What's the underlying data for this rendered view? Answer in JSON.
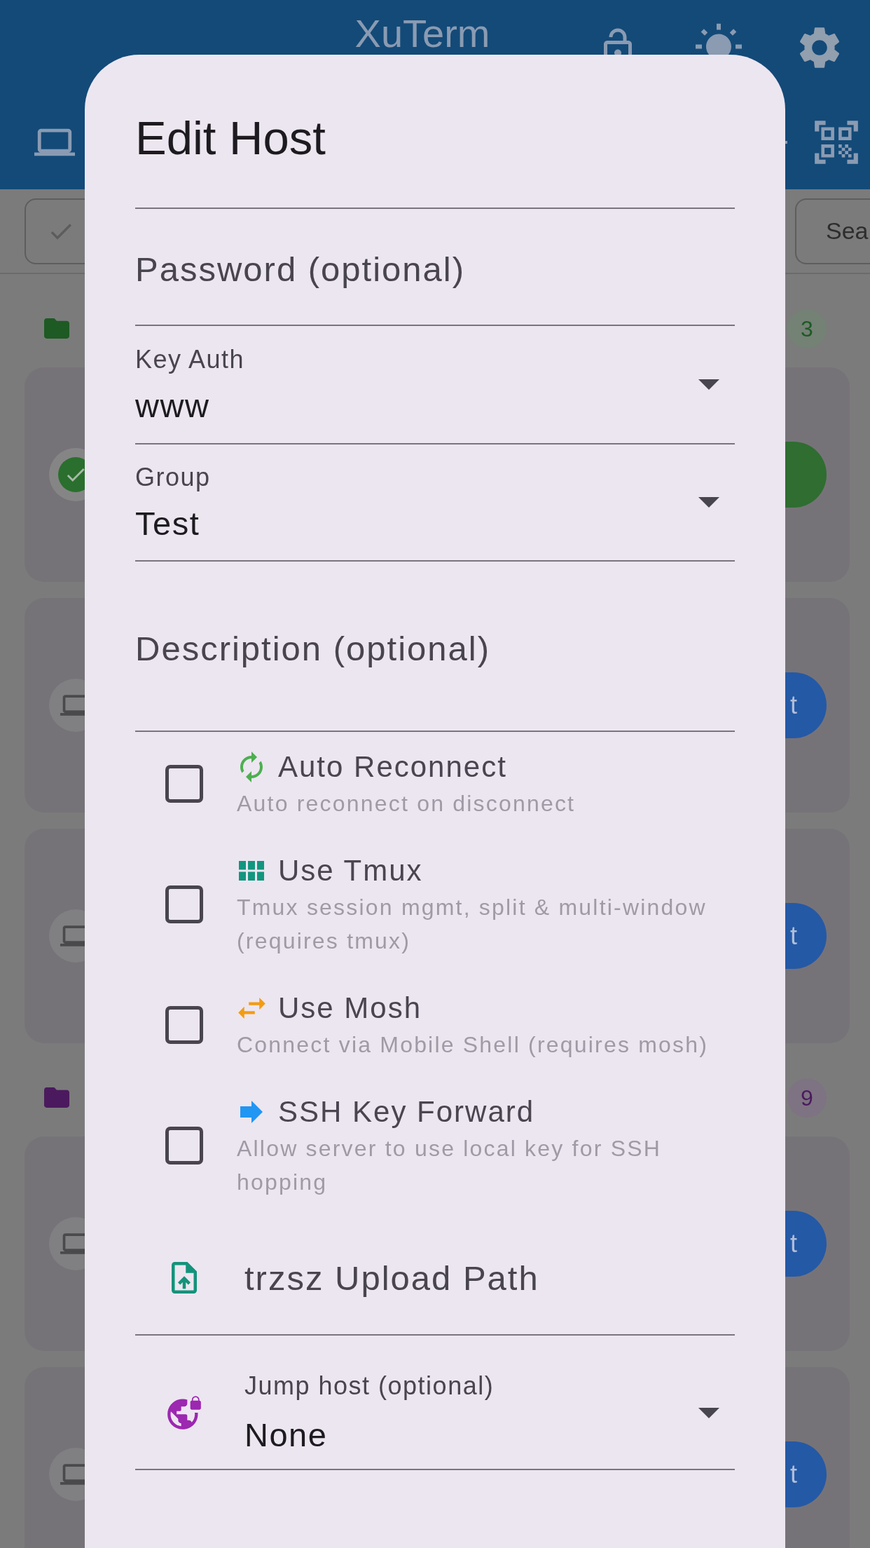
{
  "app_bar": {
    "title": "XuTerm"
  },
  "toolbar": {
    "search_button": "Sea"
  },
  "groups": [
    {
      "color": "#1e5a24",
      "count": "3",
      "hosts": [
        {
          "connected": true
        },
        {
          "connected": false,
          "button": "t"
        },
        {
          "connected": false,
          "button": "t"
        }
      ]
    },
    {
      "color": "#4b1a5e",
      "count": "9",
      "hosts": [
        {
          "connected": false,
          "button": "t"
        },
        {
          "connected": false,
          "button": "t"
        }
      ]
    }
  ],
  "dialog": {
    "title": "Edit Host",
    "fields": [
      {
        "kind": "text",
        "placeholder": "Password (optional)"
      },
      {
        "kind": "dropdown",
        "label": "Key Auth",
        "value": "www"
      },
      {
        "kind": "dropdown",
        "label": "Group",
        "value": "Test"
      },
      {
        "kind": "multiline",
        "placeholder": "Description (optional)"
      }
    ],
    "options": [
      {
        "title": "Auto Reconnect",
        "description": "Auto reconnect on disconnect",
        "checked": false
      },
      {
        "title": "Use Tmux",
        "description": "Tmux session mgmt, split & multi-window (requires tmux)",
        "checked": false
      },
      {
        "title": "Use Mosh",
        "description": "Connect via Mobile Shell (requires mosh)",
        "checked": false
      },
      {
        "title": "SSH Key Forward",
        "description": "Allow server to use local key for SSH hopping",
        "checked": false
      }
    ],
    "upload_path": {
      "placeholder": "trzsz Upload Path"
    },
    "jump_host": {
      "label": "Jump host (optional)",
      "value": "None"
    }
  }
}
